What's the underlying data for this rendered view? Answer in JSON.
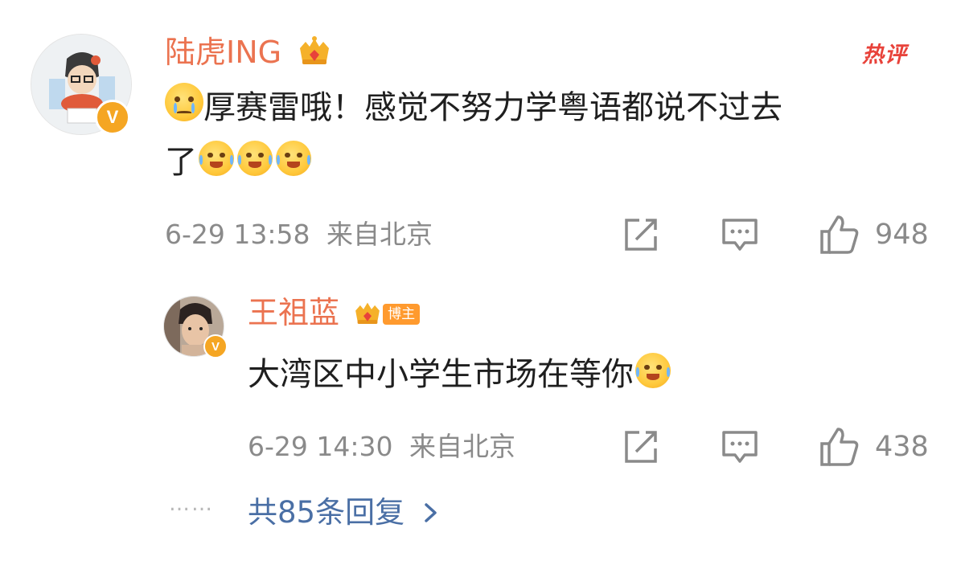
{
  "comments": [
    {
      "username": "陆虎ING",
      "text_main": "厚赛雷哦！感觉不努力学粤语都说不过去",
      "text_line2": "了",
      "date": "6-29 13:58",
      "location": "来自北京",
      "likes": "948",
      "hot_tag": "热评"
    }
  ],
  "reply": {
    "username": "王祖蓝",
    "role_tag": "博主",
    "text": "大湾区中小学生市场在等你",
    "date": "6-29 14:30",
    "location": "来自北京",
    "likes": "438"
  },
  "footer": {
    "dots": "……",
    "more_replies": "共85条回复"
  },
  "icons": {
    "verified": "V",
    "share": "share-icon",
    "comment": "comment-icon",
    "like": "thumbs-up-icon"
  },
  "colors": {
    "username": "#eb7350",
    "hot_tag": "#e8423a",
    "meta": "#8a8a8a",
    "link": "#4a6fa5",
    "badge": "#f5a623"
  }
}
